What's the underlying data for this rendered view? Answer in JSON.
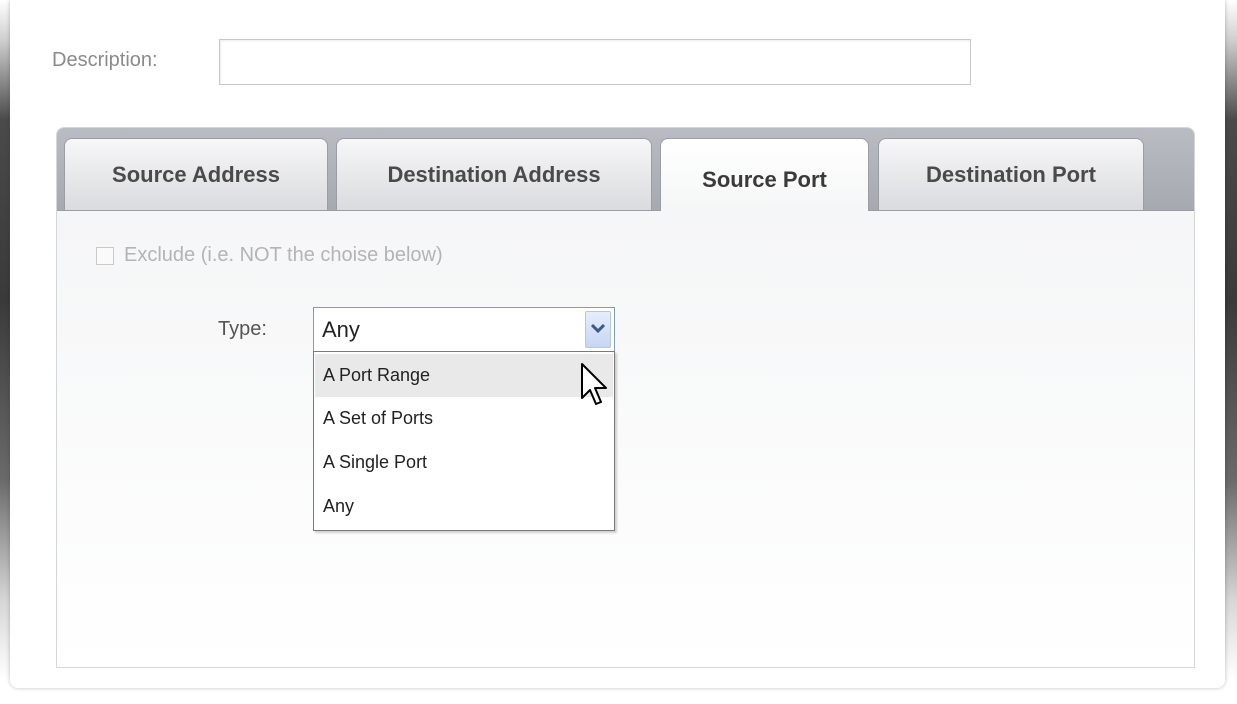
{
  "description": {
    "label": "Description:",
    "value": ""
  },
  "tabs": [
    {
      "label": "Source Address",
      "active": false
    },
    {
      "label": "Destination Address",
      "active": false
    },
    {
      "label": "Source Port",
      "active": true
    },
    {
      "label": "Destination Port",
      "active": false
    }
  ],
  "exclude": {
    "label": "Exclude (i.e. NOT the choise below)",
    "checked": false
  },
  "type": {
    "label": "Type:",
    "selected": "Any",
    "options": [
      "A Port Range",
      "A Set of Ports",
      "A Single Port",
      "Any"
    ],
    "hovered_option": "A Port Range"
  },
  "icons": {
    "dropdown_arrow": "chevron-down-icon",
    "cursor": "mouse-pointer-icon"
  }
}
